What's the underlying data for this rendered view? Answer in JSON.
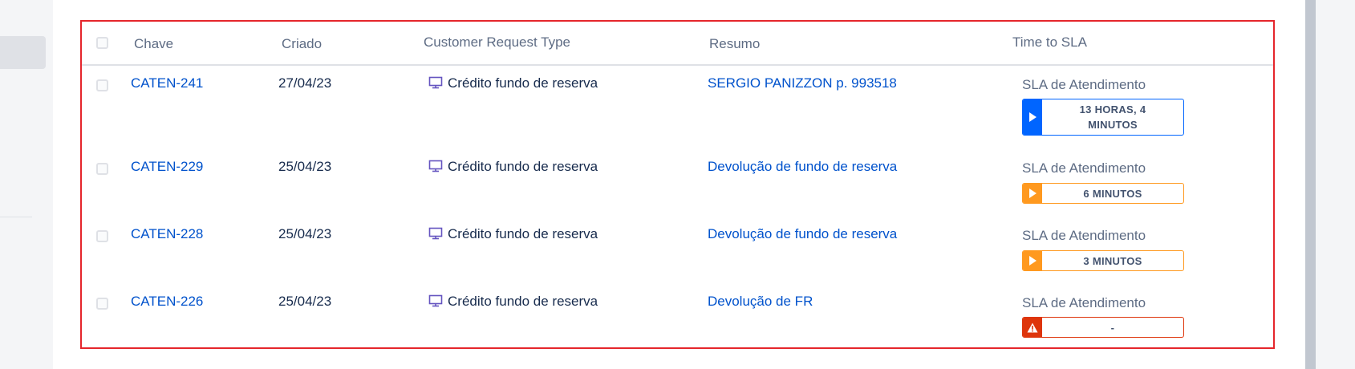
{
  "table": {
    "headers": {
      "chave": "Chave",
      "criado": "Criado",
      "request_type": "Customer Request Type",
      "resumo": "Resumo",
      "time_to_sla": "Time to SLA"
    },
    "rows": [
      {
        "key": "CATEN-241",
        "created": "27/04/23",
        "request_type": "Crédito fundo de reserva",
        "request_type_icon": "monitor-icon",
        "summary": "SERGIO PANIZZON p. 993518",
        "sla_name": "SLA de Atendimento",
        "sla_value": "13 HORAS, 4 MINUTOS",
        "sla_status": "running",
        "sla_color": "#0065ff"
      },
      {
        "key": "CATEN-229",
        "created": "25/04/23",
        "request_type": "Crédito fundo de reserva",
        "request_type_icon": "monitor-icon",
        "summary": "Devolução de fundo de reserva",
        "sla_name": "SLA de Atendimento",
        "sla_value": "6 MINUTOS",
        "sla_status": "warning",
        "sla_color": "#ff991f"
      },
      {
        "key": "CATEN-228",
        "created": "25/04/23",
        "request_type": "Crédito fundo de reserva",
        "request_type_icon": "monitor-icon",
        "summary": "Devolução de fundo de reserva",
        "sla_name": "SLA de Atendimento",
        "sla_value": "3 MINUTOS",
        "sla_status": "warning",
        "sla_color": "#ff991f"
      },
      {
        "key": "CATEN-226",
        "created": "25/04/23",
        "request_type": "Crédito fundo de reserva",
        "request_type_icon": "monitor-icon",
        "summary": "Devolução de FR",
        "sla_name": "SLA de Atendimento",
        "sla_value": "-",
        "sla_status": "breached",
        "sla_color": "#de350b"
      }
    ]
  },
  "colors": {
    "link": "#0052cc",
    "highlight_border": "#e5262c"
  }
}
